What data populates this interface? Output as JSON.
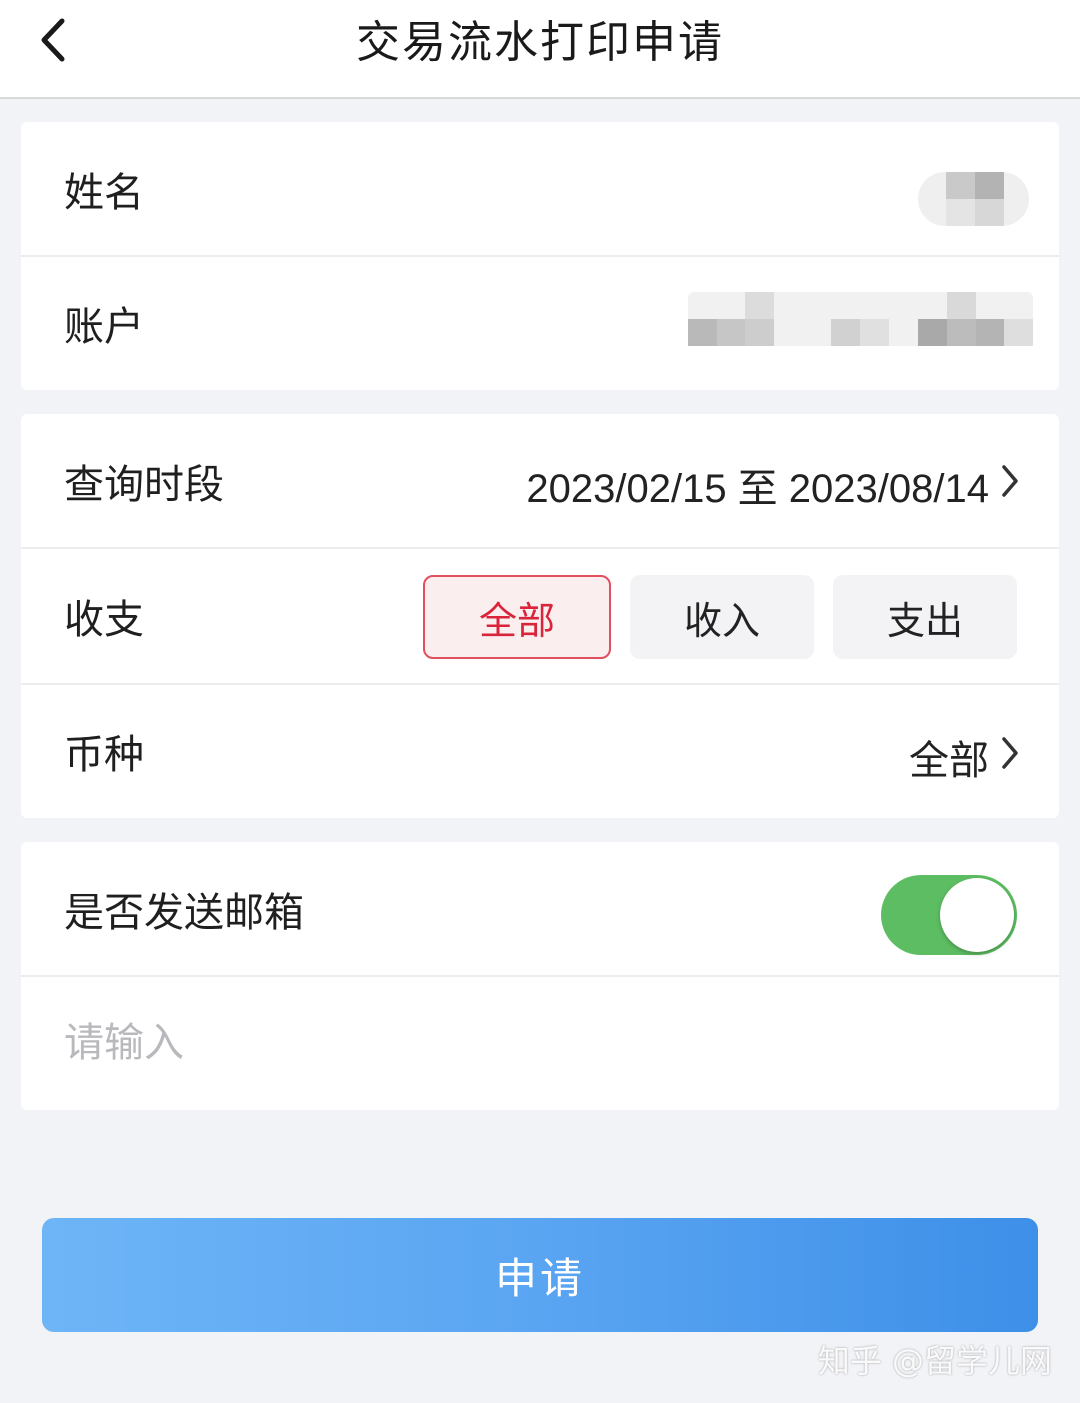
{
  "header": {
    "title": "交易流水打印申请",
    "back_icon": "chevron-left-icon"
  },
  "account_info": {
    "name_label": "姓名",
    "account_label": "账户"
  },
  "query": {
    "period_label": "查询时段",
    "period_value": "2023/02/15 至 2023/08/14",
    "direction_label": "收支",
    "direction_options": [
      "全部",
      "收入",
      "支出"
    ],
    "direction_selected": "全部",
    "currency_label": "币种",
    "currency_value": "全部"
  },
  "email": {
    "send_label": "是否发送邮箱",
    "toggle_on": true,
    "input_placeholder": "请输入",
    "input_value": ""
  },
  "submit": {
    "label": "申请"
  },
  "watermark": "知乎 @留学儿网",
  "colors": {
    "accent_red": "#d9253b",
    "toggle_green": "#5dbd62",
    "button_blue": "#4a9bef",
    "page_bg": "#f2f3f7"
  }
}
